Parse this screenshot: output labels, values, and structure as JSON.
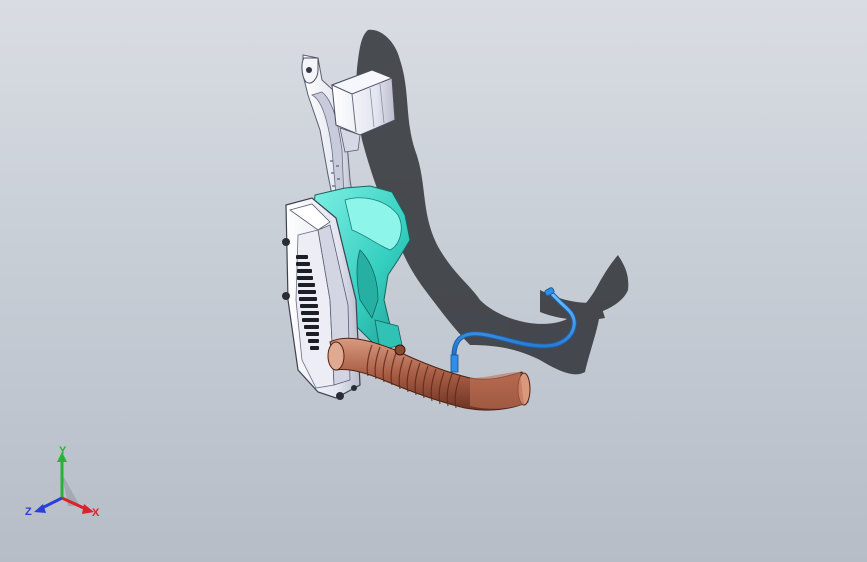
{
  "viewport": {
    "background_top": "#d9dde3",
    "background_bottom": "#b6bdc7"
  },
  "model": {
    "parts": [
      {
        "name": "backpack-frame",
        "color": "#e6e8f4"
      },
      {
        "name": "blower-housing",
        "color": "#3fd9c9"
      },
      {
        "name": "fan-cover",
        "color": "#f2f3f8"
      },
      {
        "name": "engine-cylinder",
        "color": "#e8eaf3"
      },
      {
        "name": "flex-hose",
        "color": "#b0674f"
      },
      {
        "name": "throttle-cable",
        "color": "#2f8fe6"
      }
    ]
  },
  "triad": {
    "x_label": "X",
    "y_label": "Y",
    "z_label": "Z",
    "x_color": "#d9232b",
    "y_color": "#27b33a",
    "z_color": "#2b3fd6"
  }
}
